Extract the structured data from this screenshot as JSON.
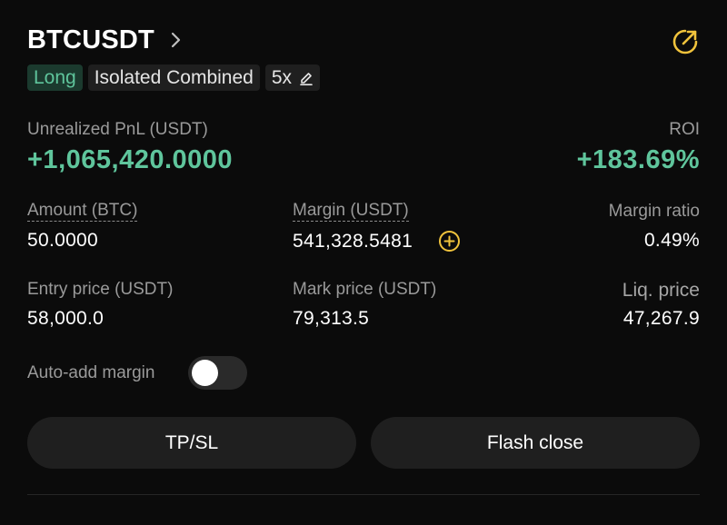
{
  "position": {
    "symbol": "BTCUSDT",
    "tags": {
      "side": "Long",
      "margin_mode": "Isolated Combined",
      "leverage": "5x"
    },
    "pnl": {
      "label": "Unrealized PnL (USDT)",
      "value": "+1,065,420.0000"
    },
    "roi": {
      "label": "ROI",
      "value": "+183.69%"
    },
    "amount": {
      "label": "Amount (BTC)",
      "value": "50.0000"
    },
    "margin": {
      "label": "Margin (USDT)",
      "value": "541,328.5481"
    },
    "margin_ratio": {
      "label": "Margin ratio",
      "value": "0.49%"
    },
    "entry_price": {
      "label": "Entry price (USDT)",
      "value": "58,000.0"
    },
    "mark_price": {
      "label": "Mark price (USDT)",
      "value": "79,313.5"
    },
    "liq_price": {
      "label": "Liq. price",
      "value": "47,267.9"
    },
    "auto_add_margin": {
      "label": "Auto-add margin",
      "enabled": false
    }
  },
  "actions": {
    "tpsl_label": "TP/SL",
    "flash_close_label": "Flash close"
  },
  "icons": {
    "title_chevron": "chevron-right-icon",
    "share": "share-icon",
    "leverage_edit": "pencil-icon",
    "add_margin": "plus-circle-icon"
  },
  "colors": {
    "profit": "#5fc59c",
    "accent": "#f0c33c",
    "background": "#0b0b0b",
    "button": "#1f1f1f"
  }
}
